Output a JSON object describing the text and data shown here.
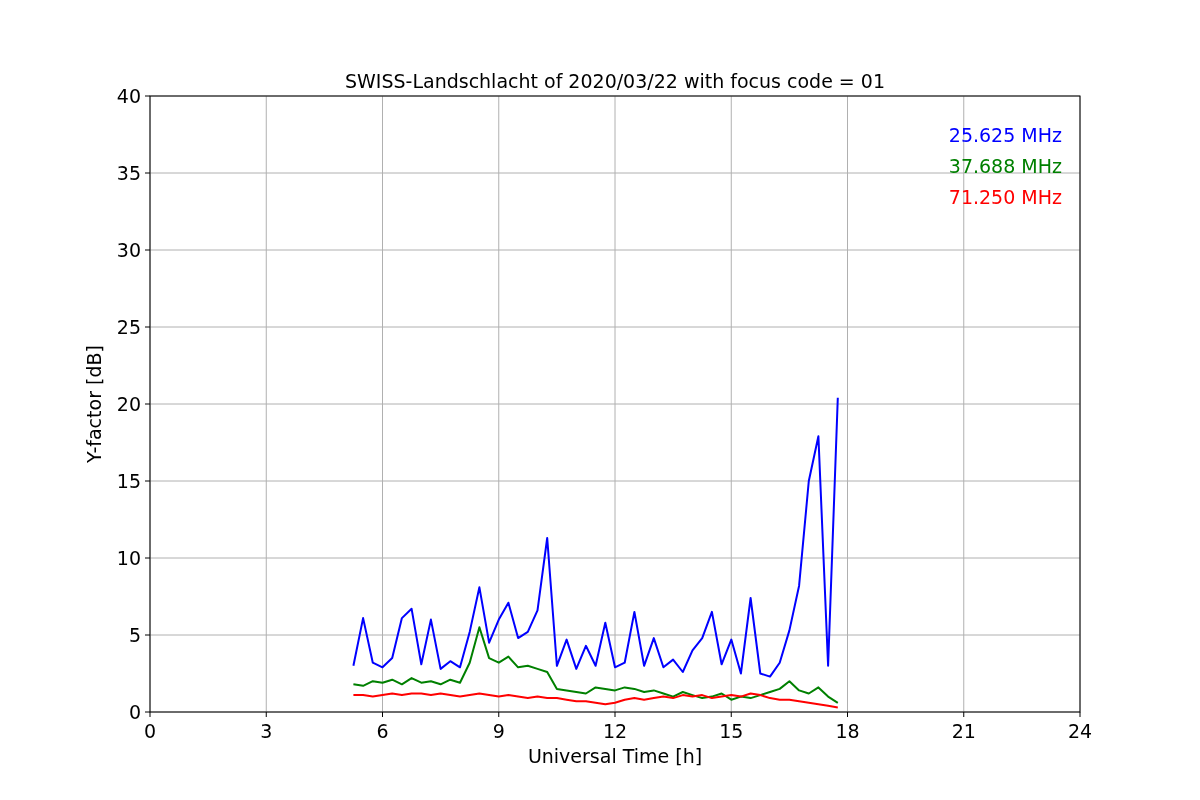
{
  "figure": {
    "chart_data": {
      "type": "line",
      "title": "SWISS-Landschlacht of 2020/03/22 with focus code = 01",
      "xlabel": "Universal Time [h]",
      "ylabel": "Y-factor [dB]",
      "x": [
        5.25,
        5.5,
        5.75,
        6.0,
        6.25,
        6.5,
        6.75,
        7.0,
        7.25,
        7.5,
        7.75,
        8.0,
        8.25,
        8.5,
        8.75,
        9.0,
        9.25,
        9.5,
        9.75,
        10.0,
        10.25,
        10.5,
        10.75,
        11.0,
        11.25,
        11.5,
        11.75,
        12.0,
        12.25,
        12.5,
        12.75,
        13.0,
        13.25,
        13.5,
        13.75,
        14.0,
        14.25,
        14.5,
        14.75,
        15.0,
        15.25,
        15.5,
        15.75,
        16.0,
        16.25,
        16.5,
        16.75,
        17.0,
        17.25,
        17.5,
        17.75
      ],
      "series": [
        {
          "name": "25.625 MHz",
          "color": "#0000ff",
          "values": [
            3.0,
            6.1,
            3.2,
            2.9,
            3.5,
            6.1,
            6.7,
            3.1,
            6.0,
            2.8,
            3.3,
            2.9,
            5.2,
            8.1,
            4.5,
            6.0,
            7.1,
            4.8,
            5.2,
            6.6,
            11.3,
            3.0,
            4.7,
            2.8,
            4.3,
            3.0,
            5.8,
            2.9,
            3.2,
            6.5,
            3.0,
            4.8,
            2.9,
            3.4,
            2.6,
            4.0,
            4.8,
            6.5,
            3.1,
            4.7,
            2.5,
            7.4,
            2.5,
            2.3,
            3.2,
            5.3,
            8.2,
            15.0,
            17.9,
            3.0,
            20.4
          ]
        },
        {
          "name": "37.688 MHz",
          "color": "#008000",
          "values": [
            1.8,
            1.7,
            2.0,
            1.9,
            2.1,
            1.8,
            2.2,
            1.9,
            2.0,
            1.8,
            2.1,
            1.9,
            3.2,
            5.5,
            3.5,
            3.2,
            3.6,
            2.9,
            3.0,
            2.8,
            2.6,
            1.5,
            1.4,
            1.3,
            1.2,
            1.6,
            1.5,
            1.4,
            1.6,
            1.5,
            1.3,
            1.4,
            1.2,
            1.0,
            1.3,
            1.1,
            0.9,
            1.0,
            1.2,
            0.8,
            1.0,
            0.9,
            1.1,
            1.3,
            1.5,
            2.0,
            1.4,
            1.2,
            1.6,
            1.0,
            0.6
          ]
        },
        {
          "name": "71.250 MHz",
          "color": "#ff0000",
          "values": [
            1.1,
            1.1,
            1.0,
            1.1,
            1.2,
            1.1,
            1.2,
            1.2,
            1.1,
            1.2,
            1.1,
            1.0,
            1.1,
            1.2,
            1.1,
            1.0,
            1.1,
            1.0,
            0.9,
            1.0,
            0.9,
            0.9,
            0.8,
            0.7,
            0.7,
            0.6,
            0.5,
            0.6,
            0.8,
            0.9,
            0.8,
            0.9,
            1.0,
            0.9,
            1.1,
            1.0,
            1.1,
            0.9,
            1.0,
            1.1,
            1.0,
            1.2,
            1.1,
            0.9,
            0.8,
            0.8,
            0.7,
            0.6,
            0.5,
            0.4,
            0.3
          ]
        }
      ],
      "grid": true,
      "xlim": [
        0,
        24
      ],
      "ylim": [
        0,
        40
      ],
      "xticks": [
        0,
        3,
        6,
        9,
        12,
        15,
        18,
        21,
        24
      ],
      "yticks": [
        0,
        5,
        10,
        15,
        20,
        25,
        30,
        35,
        40
      ]
    }
  }
}
